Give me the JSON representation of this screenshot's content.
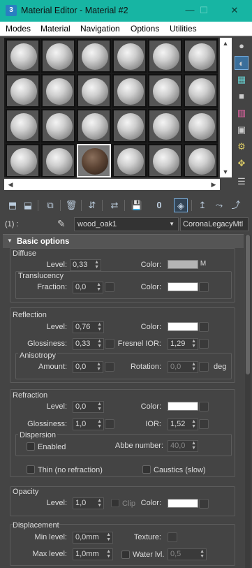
{
  "window": {
    "title": "Material Editor - Material #2",
    "minimize": "—",
    "maximize": "☐",
    "close": "✕"
  },
  "menu": [
    "Modes",
    "Material",
    "Navigation",
    "Options",
    "Utilities"
  ],
  "slots": {
    "selected_index": 20,
    "count": 24
  },
  "name_bar": {
    "slot_label": "(1) :",
    "material_name": "wood_oak1",
    "material_type": "CoronaLegacyMtl"
  },
  "rollout": {
    "title": "Basic options"
  },
  "diffuse": {
    "group": "Diffuse",
    "level_label": "Level:",
    "level": "0,33",
    "color_label": "Color:",
    "color": "#b4b4b4",
    "map_btn": "M",
    "translucency": {
      "group": "Translucency",
      "fraction_label": "Fraction:",
      "fraction": "0,0",
      "color_label": "Color:",
      "color": "#ffffff"
    }
  },
  "reflection": {
    "group": "Reflection",
    "level_label": "Level:",
    "level": "0,76",
    "color_label": "Color:",
    "color": "#ffffff",
    "gloss_label": "Glossiness:",
    "gloss": "0,33",
    "fresnel_label": "Fresnel IOR:",
    "fresnel": "1,29",
    "aniso": {
      "group": "Anisotropy",
      "amount_label": "Amount:",
      "amount": "0,0",
      "rotation_label": "Rotation:",
      "rotation": "0,0",
      "deg": "deg"
    }
  },
  "refraction": {
    "group": "Refraction",
    "level_label": "Level:",
    "level": "0,0",
    "color_label": "Color:",
    "color": "#ffffff",
    "gloss_label": "Glossiness:",
    "gloss": "1,0",
    "ior_label": "IOR:",
    "ior": "1,52",
    "dispersion": {
      "group": "Dispersion",
      "enabled_label": "Enabled",
      "abbe_label": "Abbe number:",
      "abbe": "40,0"
    },
    "thin_label": "Thin (no refraction)",
    "caustics_label": "Caustics (slow)"
  },
  "opacity": {
    "group": "Opacity",
    "level_label": "Level:",
    "level": "1,0",
    "clip_label": "Clip",
    "color_label": "Color:",
    "color": "#ffffff"
  },
  "displacement": {
    "group": "Displacement",
    "min_label": "Min level:",
    "min": "0,0mm",
    "texture_label": "Texture:",
    "max_label": "Max level:",
    "max": "1,0mm",
    "water_label": "Water lvl.",
    "water": "0,5"
  }
}
